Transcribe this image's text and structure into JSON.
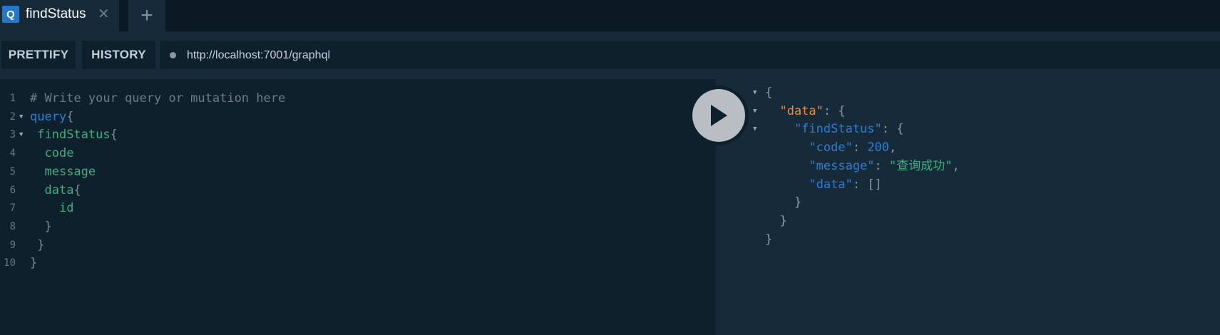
{
  "tabs": [
    {
      "badge": "Q",
      "title": "findStatus",
      "close": "✕"
    }
  ],
  "add_tab": "+",
  "toolbar": {
    "prettify": "PRETTIFY",
    "history": "HISTORY",
    "endpoint": "http://localhost:7001/graphql"
  },
  "editor": {
    "line_numbers": [
      "1",
      "2",
      "3",
      "4",
      "5",
      "6",
      "7",
      "8",
      "9",
      "10"
    ],
    "lines": [
      {
        "indent": "",
        "parts": [
          {
            "t": "# Write your query or mutation here",
            "k": "comment"
          }
        ]
      },
      {
        "indent": "",
        "parts": [
          {
            "t": "query",
            "k": "kw"
          },
          {
            "t": "{",
            "k": "punc"
          }
        ]
      },
      {
        "indent": " ",
        "parts": [
          {
            "t": "findStatus",
            "k": "field"
          },
          {
            "t": "{",
            "k": "punc"
          }
        ]
      },
      {
        "indent": "  ",
        "parts": [
          {
            "t": "code",
            "k": "field"
          }
        ]
      },
      {
        "indent": "  ",
        "parts": [
          {
            "t": "message",
            "k": "field"
          }
        ]
      },
      {
        "indent": "  ",
        "parts": [
          {
            "t": "data",
            "k": "field"
          },
          {
            "t": "{",
            "k": "punc"
          }
        ]
      },
      {
        "indent": "    ",
        "parts": [
          {
            "t": "id",
            "k": "field"
          }
        ]
      },
      {
        "indent": "  ",
        "parts": [
          {
            "t": "}",
            "k": "punc"
          }
        ]
      },
      {
        "indent": " ",
        "parts": [
          {
            "t": "}",
            "k": "punc"
          }
        ]
      },
      {
        "indent": "",
        "parts": [
          {
            "t": "}",
            "k": "punc"
          }
        ]
      }
    ]
  },
  "result": {
    "lines": [
      {
        "parts": [
          {
            "t": "{",
            "k": "punc"
          }
        ]
      },
      {
        "parts": [
          {
            "t": "  \"data\"",
            "k": "key-orange"
          },
          {
            "t": ": {",
            "k": "punc"
          }
        ]
      },
      {
        "parts": [
          {
            "t": "    \"findStatus\"",
            "k": "key"
          },
          {
            "t": ": {",
            "k": "punc"
          }
        ]
      },
      {
        "parts": [
          {
            "t": "      \"code\"",
            "k": "key"
          },
          {
            "t": ": ",
            "k": "punc"
          },
          {
            "t": "200",
            "k": "num"
          },
          {
            "t": ",",
            "k": "punc"
          }
        ]
      },
      {
        "parts": [
          {
            "t": "      \"message\"",
            "k": "key"
          },
          {
            "t": ": ",
            "k": "punc"
          },
          {
            "t": "\"查询成功\"",
            "k": "str"
          },
          {
            "t": ",",
            "k": "punc"
          }
        ]
      },
      {
        "parts": [
          {
            "t": "      \"data\"",
            "k": "key"
          },
          {
            "t": ": []",
            "k": "punc"
          }
        ]
      },
      {
        "parts": [
          {
            "t": "    }",
            "k": "punc"
          }
        ]
      },
      {
        "parts": [
          {
            "t": "  }",
            "k": "punc"
          }
        ]
      },
      {
        "parts": [
          {
            "t": "}",
            "k": "punc"
          }
        ]
      }
    ]
  },
  "colors": {
    "keyword": "#2a7ed3",
    "field": "#3cb07e",
    "comment": "#6e7b85",
    "json_key_top": "#ee8b3d",
    "background": "#172a3a"
  },
  "icons": {
    "run": "play-icon",
    "fold": "triangle-down-icon"
  }
}
